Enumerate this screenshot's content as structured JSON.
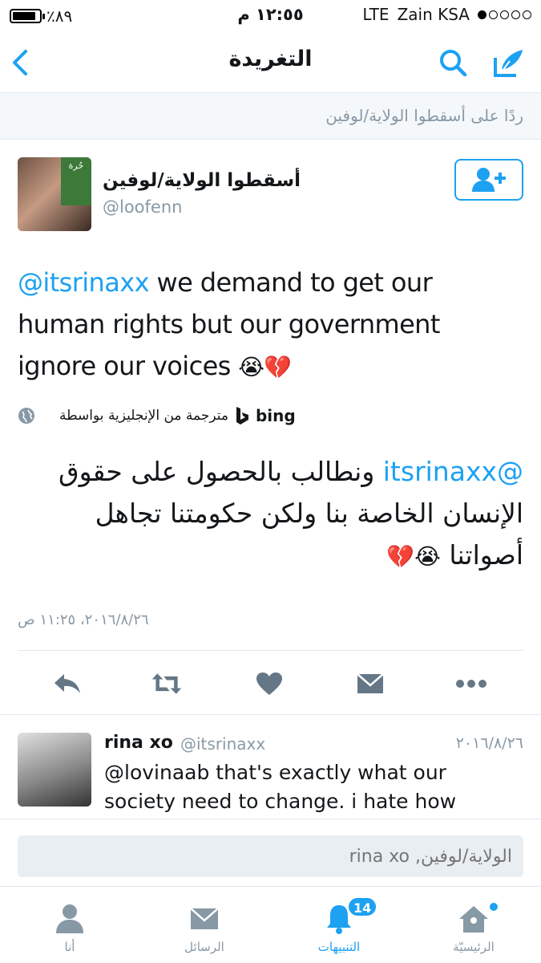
{
  "status_bar": {
    "battery_percent_label": "٪٨٩",
    "battery_level": 0.89,
    "time": "١٢:٥٥ م",
    "network": "LTE",
    "carrier": "Zain KSA",
    "signal_bars_filled": 1
  },
  "nav": {
    "title": "التغريدة",
    "back_icon": "chevron-left-icon",
    "search_icon": "search-icon",
    "compose_icon": "compose-icon"
  },
  "reply_context": {
    "text": "ردًا على  أسقطوا الولاية/لوفين"
  },
  "tweet": {
    "author_name": "أسقطوا الولاية/لوفين",
    "author_handle": "@loofenn",
    "avatar_badge": "حُرة",
    "follow_icon": "add-user-icon",
    "text_mention": "@itsrinaxx",
    "text_body": " we demand to get our human rights but our government ignore our voices ",
    "text_emojis": "😭💔",
    "translation_label": "مترجمة من الإنجليزية بواسطة",
    "translation_provider": "bing",
    "translated_mention": "@itsrinaxx",
    "translated_body": " ونطالب بالحصول على حقوق الإنسان الخاصة بنا ولكن حكومتنا تجاهل أصواتنا ",
    "translated_emojis": "😭💔",
    "timestamp": "٢٠١٦/٨/٢٦، ١١:٢٥ ص",
    "actions": {
      "reply": "reply-icon",
      "retweet": "retweet-icon",
      "like": "heart-icon",
      "message": "message-icon",
      "more": "more-icon"
    }
  },
  "reply_tweet": {
    "name": "rina xo",
    "handle": "@itsrinaxx",
    "date": "٢٠١٦/٨/٢٦",
    "text": "@lovinaab that's exactly what our society need to change. i hate how"
  },
  "reply_bar": {
    "placeholder": "الولاية/لوفين, rina xo"
  },
  "tabs": [
    {
      "label": "الرئيسيّة",
      "icon": "home-icon",
      "active": false
    },
    {
      "label": "التنبيهات",
      "icon": "bell-icon",
      "active": true,
      "badge": "14"
    },
    {
      "label": "الرسائل",
      "icon": "envelope-icon",
      "active": false
    },
    {
      "label": "أنا",
      "icon": "user-icon",
      "active": false
    }
  ],
  "colors": {
    "accent": "#1da1f2",
    "muted": "#8899a6",
    "icon_gray": "#657786",
    "border": "#e1e8ed"
  }
}
